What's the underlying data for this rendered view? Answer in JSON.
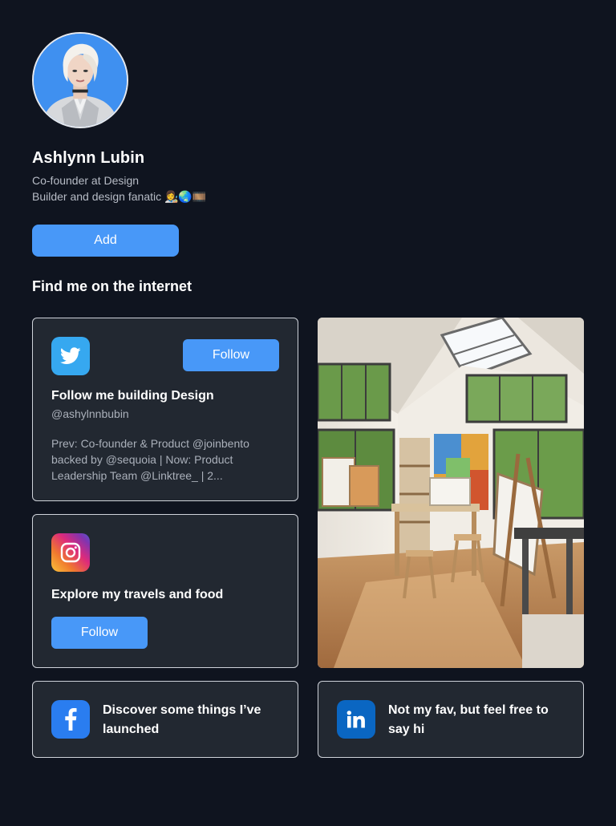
{
  "profile": {
    "name": "Ashlynn Lubin",
    "bio_line_1": "Co-founder at Design",
    "bio_line_2": "Builder and design fanatic 👩‍🎨🌏🎞️",
    "avatar_icon": "avatar-portrait"
  },
  "actions": {
    "add_label": "Add"
  },
  "section": {
    "title": "Find me on the internet"
  },
  "cards": {
    "twitter": {
      "icon": "twitter-icon",
      "follow_label": "Follow",
      "title": "Follow me building Design",
      "handle": "@ashylnnbubin",
      "description": "Prev: Co-founder & Product @joinbento backed by @sequoia | Now: Product Leadership Team @Linktree_ | 2..."
    },
    "instagram": {
      "icon": "instagram-icon",
      "title": "Explore my travels and food",
      "follow_label": "Follow"
    },
    "facebook": {
      "icon": "facebook-icon",
      "text": "Discover some things I’ve launched"
    },
    "linkedin": {
      "icon": "linkedin-icon",
      "text": "Not my fav, but feel free to say hi"
    },
    "studio_image": {
      "icon": "art-studio-photo"
    }
  },
  "colors": {
    "background": "#0f141f",
    "card": "#222831",
    "accent": "#4898f8",
    "twitter": "#36a8f0",
    "facebook": "#2a7df0",
    "linkedin": "#0a66c2"
  }
}
